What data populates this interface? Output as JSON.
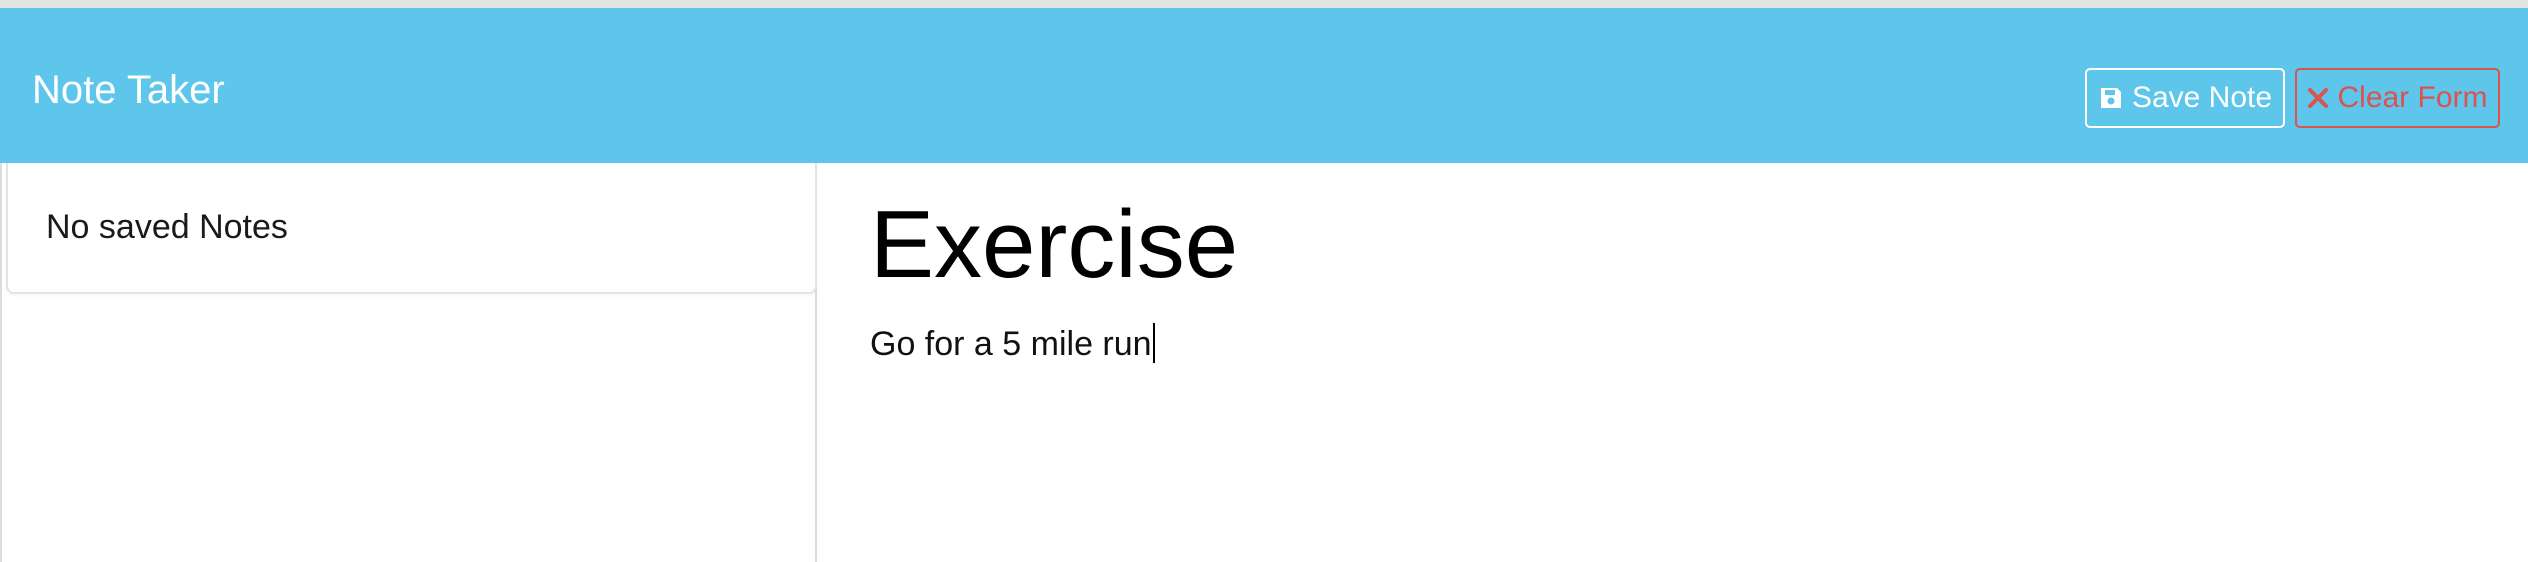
{
  "navbar": {
    "brand": "Note Taker",
    "background": "#5dc6ea",
    "save_button": {
      "label": "Save Note",
      "icon": "save-icon"
    },
    "clear_button": {
      "label": "Clear Form",
      "icon": "close-icon",
      "color": "#d9534f"
    }
  },
  "sidebar": {
    "empty_message": "No saved Notes"
  },
  "editor": {
    "title": "Exercise",
    "body": "Go for a 5 mile run"
  }
}
